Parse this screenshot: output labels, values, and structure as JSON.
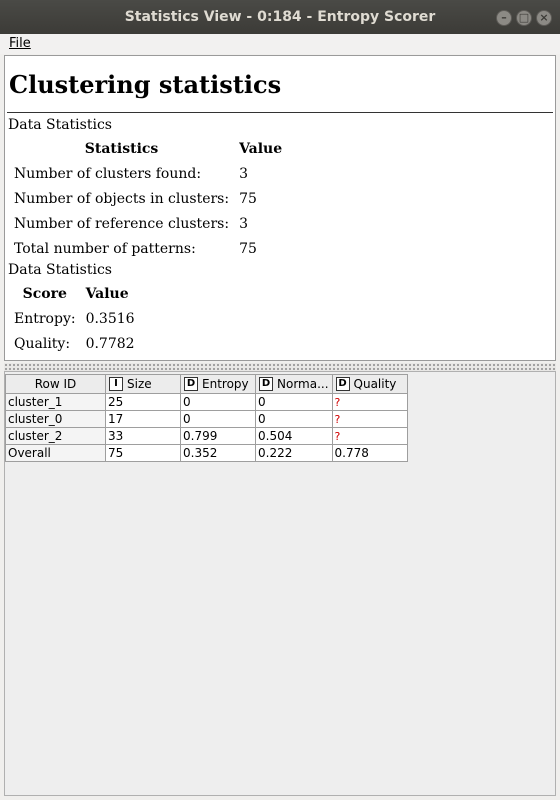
{
  "window": {
    "title": "Statistics View - 0:184 - Entropy Scorer"
  },
  "menu": {
    "file_label": "File"
  },
  "report": {
    "heading": "Clustering statistics",
    "section1_label": "Data Statistics",
    "table1": {
      "headers": [
        "Statistics",
        "Value"
      ],
      "rows": [
        [
          "Number of clusters found:",
          "3"
        ],
        [
          "Number of objects in clusters:",
          "75"
        ],
        [
          "Number of reference clusters:",
          "3"
        ],
        [
          "Total number of patterns:",
          "75"
        ]
      ]
    },
    "section2_label": "Data Statistics",
    "table2": {
      "headers": [
        "Score",
        "Value"
      ],
      "rows": [
        [
          "Entropy:",
          "0.3516"
        ],
        [
          "Quality:",
          "0.7782"
        ]
      ]
    }
  },
  "grid": {
    "headers": [
      {
        "label": "Row ID",
        "type": ""
      },
      {
        "label": "Size",
        "type": "I"
      },
      {
        "label": "Entropy",
        "type": "D"
      },
      {
        "label": "Norma...",
        "type": "D"
      },
      {
        "label": "Quality",
        "type": "D"
      }
    ],
    "rows": [
      [
        "cluster_1",
        "25",
        "0",
        "0",
        "?"
      ],
      [
        "cluster_0",
        "17",
        "0",
        "0",
        "?"
      ],
      [
        "cluster_2",
        "33",
        "0.799",
        "0.504",
        "?"
      ],
      [
        "Overall",
        "75",
        "0.352",
        "0.222",
        "0.778"
      ]
    ]
  }
}
